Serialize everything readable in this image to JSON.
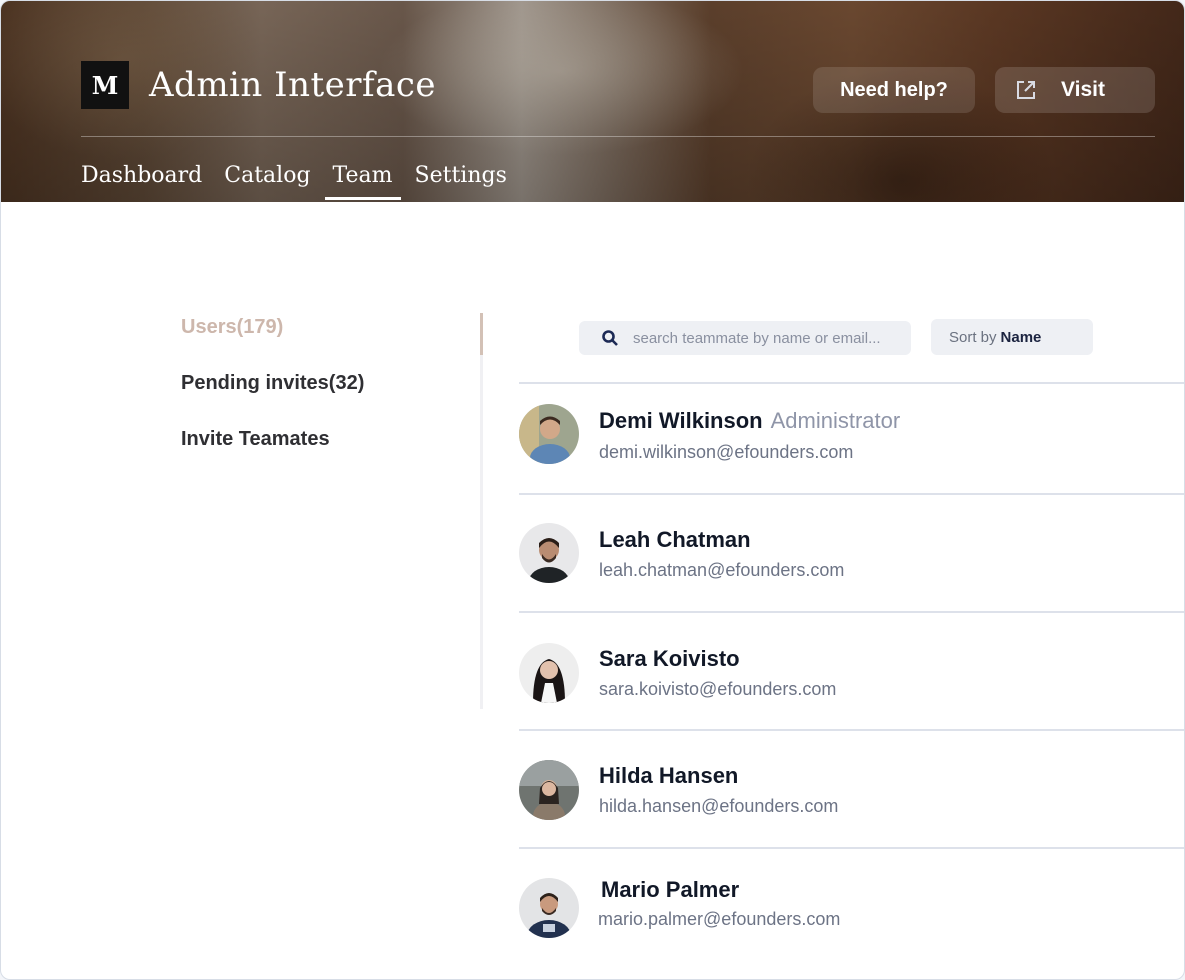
{
  "app": {
    "logo_letter": "M",
    "title": "Admin Interface"
  },
  "header": {
    "help_label": "Need help?",
    "visit_label": "Visit"
  },
  "nav": {
    "tabs": [
      {
        "label": "Dashboard",
        "active": false
      },
      {
        "label": "Catalog",
        "active": false
      },
      {
        "label": "Team",
        "active": true
      },
      {
        "label": "Settings",
        "active": false
      }
    ]
  },
  "side_menu": {
    "items": [
      {
        "label": "Users(179)",
        "active": true
      },
      {
        "label": "Pending invites(32)",
        "active": false
      },
      {
        "label": "Invite Teamates",
        "active": false
      }
    ]
  },
  "search": {
    "placeholder": "search teammate by name or email...",
    "icon": "search-icon"
  },
  "sort": {
    "prefix": "Sort by",
    "value": "Name"
  },
  "users": [
    {
      "name": "Demi Wilkinson",
      "role": "Administrator",
      "email": "demi.wilkinson@efounders.com"
    },
    {
      "name": "Leah Chatman",
      "role": "",
      "email": "leah.chatman@efounders.com"
    },
    {
      "name": "Sara Koivisto",
      "role": "",
      "email": "sara.koivisto@efounders.com"
    },
    {
      "name": "Hilda Hansen",
      "role": "",
      "email": "hilda.hansen@efounders.com"
    },
    {
      "name": "Mario Palmer",
      "role": "",
      "email": "mario.palmer@efounders.com"
    }
  ],
  "colors": {
    "active_side_item": "#cdb7ac",
    "role_text": "#8f95a8",
    "email_text": "#6c7385"
  }
}
